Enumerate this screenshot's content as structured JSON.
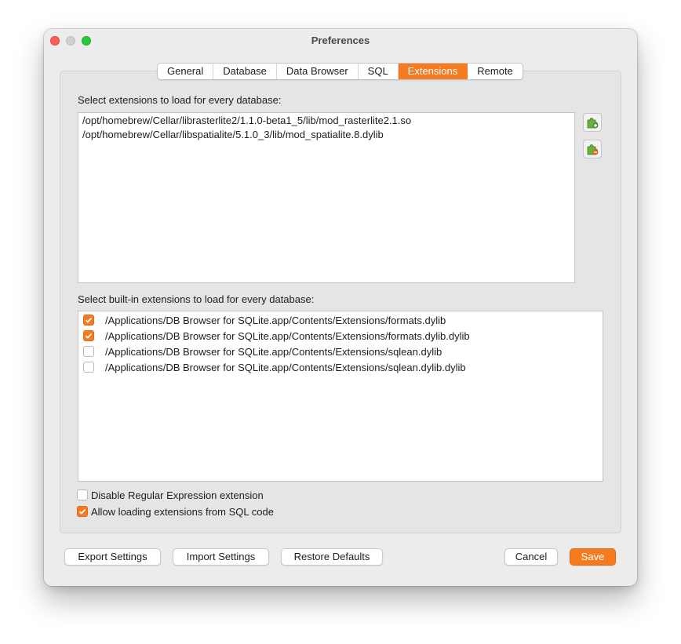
{
  "window": {
    "title": "Preferences"
  },
  "tabs": [
    {
      "label": "General"
    },
    {
      "label": "Database"
    },
    {
      "label": "Data Browser"
    },
    {
      "label": "SQL"
    },
    {
      "label": "Extensions",
      "active": true
    },
    {
      "label": "Remote"
    }
  ],
  "extensions": {
    "label": "Select extensions to load for every database:",
    "items": [
      "/opt/homebrew/Cellar/librasterlite2/1.1.0-beta1_5/lib/mod_rasterlite2.1.so",
      "/opt/homebrew/Cellar/libspatialite/5.1.0_3/lib/mod_spatialite.8.dylib"
    ],
    "add_icon": "puzzle-add-icon",
    "remove_icon": "puzzle-remove-icon"
  },
  "builtin": {
    "label": "Select built-in extensions to load for every database:",
    "items": [
      {
        "path": "/Applications/DB Browser for SQLite.app/Contents/Extensions/formats.dylib",
        "checked": true
      },
      {
        "path": "/Applications/DB Browser for SQLite.app/Contents/Extensions/formats.dylib.dylib",
        "checked": true
      },
      {
        "path": "/Applications/DB Browser for SQLite.app/Contents/Extensions/sqlean.dylib",
        "checked": false
      },
      {
        "path": "/Applications/DB Browser for SQLite.app/Contents/Extensions/sqlean.dylib.dylib",
        "checked": false
      }
    ]
  },
  "options": {
    "disable_regex": {
      "label": "Disable Regular Expression extension",
      "checked": false
    },
    "allow_sql_loading": {
      "label": "Allow loading extensions from SQL code",
      "checked": true
    }
  },
  "buttons": {
    "export": "Export Settings",
    "import": "Import Settings",
    "restore": "Restore Defaults",
    "cancel": "Cancel",
    "save": "Save"
  },
  "colors": {
    "accent": "#f47b20",
    "close": "#fe5f57",
    "minimize": "#cfcfcf",
    "maximize": "#28c840"
  }
}
